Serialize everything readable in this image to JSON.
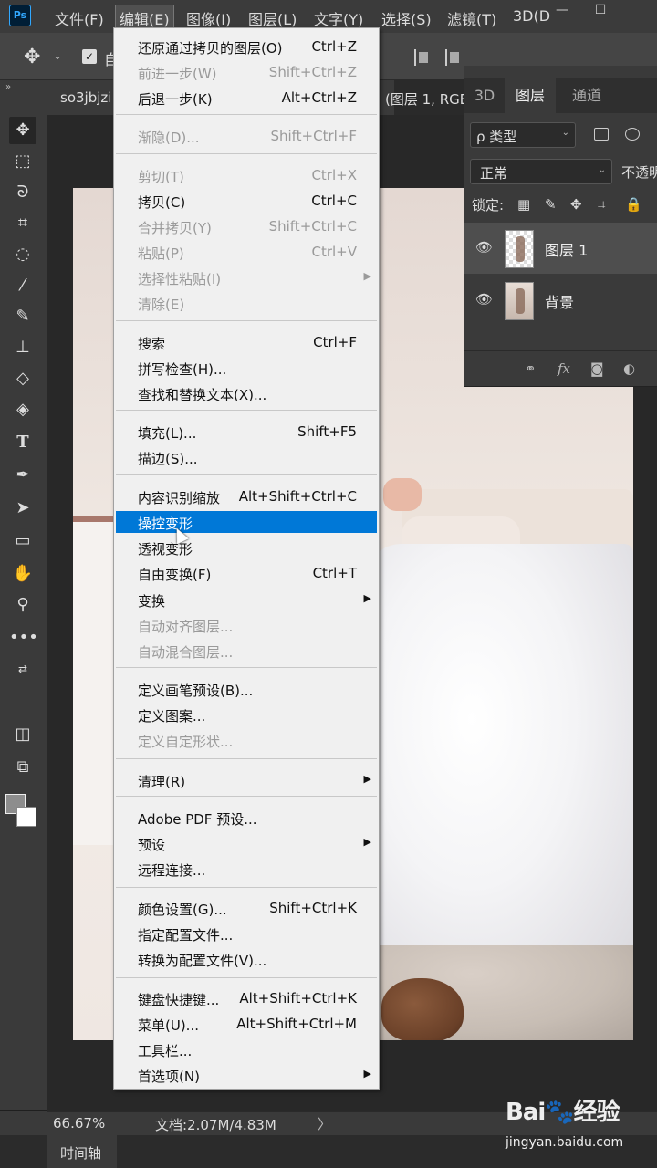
{
  "app": {
    "logo": "Ps"
  },
  "menubar": {
    "items": [
      "文件(F)",
      "编辑(E)",
      "图像(I)",
      "图层(L)",
      "文字(Y)",
      "选择(S)",
      "滤镜(T)",
      "3D(D"
    ],
    "window_controls": {
      "minimize": "—",
      "maximize": "☐"
    }
  },
  "optionsbar": {
    "move_icon": "move-icon",
    "auto_select_partial": "自"
  },
  "tabbar": {
    "left_arrows": "»",
    "doc_name": "so3jbjzi",
    "doc_info": "(图层 1, RGB"
  },
  "toolbar": {
    "tools": [
      "move-tool",
      "marquee-tool",
      "lasso-tool",
      "crop-tool",
      "quick-select-tool",
      "eyedropper-tool",
      "brush-tool",
      "stamp-tool",
      "eraser-tool",
      "paint-bucket-tool",
      "type-tool",
      "pen-tool",
      "path-select-tool",
      "rectangle-tool",
      "hand-tool",
      "zoom-tool",
      "more-tools",
      "swap-colors",
      "quick-mask",
      "screen-mode"
    ],
    "foreground_color": "#8d8d8d",
    "background_color": "#ffffff"
  },
  "layers_panel": {
    "tabs": [
      "3D",
      "图层",
      "通道"
    ],
    "active_tab": "图层",
    "filter_label": "ρ 类型",
    "blend_mode": "正常",
    "opacity_label": "不透明",
    "lock_label": "锁定:",
    "layers": [
      {
        "name": "图层 1",
        "selected": true,
        "visible": true
      },
      {
        "name": "背景",
        "selected": false,
        "visible": true
      }
    ],
    "footer_icons": [
      "link-icon",
      "fx-icon",
      "mask-icon",
      "adjustment-icon"
    ],
    "footer_fx": "fx"
  },
  "edit_menu": {
    "items": [
      {
        "label": "还原通过拷贝的图层(O)",
        "shortcut": "Ctrl+Z",
        "disabled": false
      },
      {
        "label": "前进一步(W)",
        "shortcut": "Shift+Ctrl+Z",
        "disabled": true
      },
      {
        "label": "后退一步(K)",
        "shortcut": "Alt+Ctrl+Z",
        "disabled": false
      },
      {
        "label": "渐隐(D)...",
        "shortcut": "Shift+Ctrl+F",
        "disabled": true
      },
      {
        "label": "剪切(T)",
        "shortcut": "Ctrl+X",
        "disabled": true
      },
      {
        "label": "拷贝(C)",
        "shortcut": "Ctrl+C",
        "disabled": false
      },
      {
        "label": "合并拷贝(Y)",
        "shortcut": "Shift+Ctrl+C",
        "disabled": true
      },
      {
        "label": "粘贴(P)",
        "shortcut": "Ctrl+V",
        "disabled": true
      },
      {
        "label": "选择性粘贴(I)",
        "shortcut": "",
        "disabled": true,
        "submenu": true
      },
      {
        "label": "清除(E)",
        "shortcut": "",
        "disabled": true
      },
      {
        "label": "搜索",
        "shortcut": "Ctrl+F",
        "disabled": false
      },
      {
        "label": "拼写检查(H)...",
        "shortcut": "",
        "disabled": false
      },
      {
        "label": "查找和替换文本(X)...",
        "shortcut": "",
        "disabled": false
      },
      {
        "label": "填充(L)...",
        "shortcut": "Shift+F5",
        "disabled": false
      },
      {
        "label": "描边(S)...",
        "shortcut": "",
        "disabled": false
      },
      {
        "label": "内容识别缩放",
        "shortcut": "Alt+Shift+Ctrl+C",
        "disabled": false
      },
      {
        "label": "操控变形",
        "shortcut": "",
        "disabled": false,
        "highlighted": true
      },
      {
        "label": "透视变形",
        "shortcut": "",
        "disabled": false
      },
      {
        "label": "自由变换(F)",
        "shortcut": "Ctrl+T",
        "disabled": false
      },
      {
        "label": "变换",
        "shortcut": "",
        "disabled": false,
        "submenu": true
      },
      {
        "label": "自动对齐图层...",
        "shortcut": "",
        "disabled": true
      },
      {
        "label": "自动混合图层...",
        "shortcut": "",
        "disabled": true
      },
      {
        "label": "定义画笔预设(B)...",
        "shortcut": "",
        "disabled": false
      },
      {
        "label": "定义图案...",
        "shortcut": "",
        "disabled": false
      },
      {
        "label": "定义自定形状...",
        "shortcut": "",
        "disabled": true
      },
      {
        "label": "清理(R)",
        "shortcut": "",
        "disabled": false,
        "submenu": true
      },
      {
        "label": "Adobe PDF 预设...",
        "shortcut": "",
        "disabled": false
      },
      {
        "label": "预设",
        "shortcut": "",
        "disabled": false,
        "submenu": true
      },
      {
        "label": "远程连接...",
        "shortcut": "",
        "disabled": false
      },
      {
        "label": "颜色设置(G)...",
        "shortcut": "Shift+Ctrl+K",
        "disabled": false
      },
      {
        "label": "指定配置文件...",
        "shortcut": "",
        "disabled": false
      },
      {
        "label": "转换为配置文件(V)...",
        "shortcut": "",
        "disabled": false
      },
      {
        "label": "键盘快捷键...",
        "shortcut": "Alt+Shift+Ctrl+K",
        "disabled": false
      },
      {
        "label": "菜单(U)...",
        "shortcut": "Alt+Shift+Ctrl+M",
        "disabled": false
      },
      {
        "label": "工具栏...",
        "shortcut": "",
        "disabled": false
      },
      {
        "label": "首选项(N)",
        "shortcut": "",
        "disabled": false,
        "submenu": true
      }
    ]
  },
  "statusbar": {
    "zoom": "66.67%",
    "doc_info": "文档:2.07M/4.83M",
    "arrow": "〉"
  },
  "timeline": {
    "tab_label": "时间轴"
  },
  "watermark": {
    "logo": "Bai🐾经验",
    "url": "jingyan.baidu.com"
  }
}
